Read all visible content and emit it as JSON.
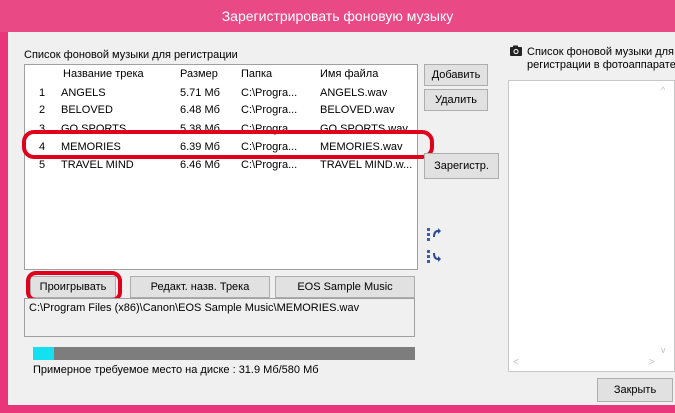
{
  "window": {
    "title": "Зарегистрировать фоновую музыку"
  },
  "left": {
    "group_label": "Список фоновой музыки для регистрации",
    "columns": [
      "Название трека",
      "Размер",
      "Папка",
      "Имя файла"
    ],
    "rows": [
      {
        "num": "1",
        "title": "ANGELS",
        "size": "5.71 Мб",
        "folder": "C:\\Progra...",
        "file": "ANGELS.wav"
      },
      {
        "num": "2",
        "title": "BELOVED",
        "size": "6.48 Мб",
        "folder": "C:\\Progra...",
        "file": "BELOVED.wav"
      },
      {
        "num": "3",
        "title": "GO SPORTS",
        "size": "5.38 Мб",
        "folder": "C:\\Progra...",
        "file": "GO SPORTS.wav"
      },
      {
        "num": "4",
        "title": "MEMORIES",
        "size": "6.39 Мб",
        "folder": "C:\\Progra...",
        "file": "MEMORIES.wav"
      },
      {
        "num": "5",
        "title": "TRAVEL MIND",
        "size": "6.46 Мб",
        "folder": "C:\\Progra...",
        "file": "TRAVEL MIND.w..."
      }
    ],
    "play_button": "Проигрывать",
    "edit_title_button": "Редакт. назв. Трека",
    "sample_button": "EOS Sample Music",
    "file_path": "C:\\Program Files (x86)\\Canon\\EOS Sample Music\\MEMORIES.wav",
    "progress_fraction": 0.055,
    "disk_space_text": "Примерное требуемое место на диске : 31.9 Мб/580 Мб"
  },
  "middle": {
    "add_button": "Добавить",
    "remove_button": "Удалить",
    "register_button": "Зарегистр."
  },
  "right": {
    "label_line1": "Список фоновой музыки для",
    "label_line2": "регистрации в фотоаппарате",
    "close_button": "Закрыть"
  },
  "colors": {
    "title_bar": "#e94a86",
    "highlight": "#e0001b",
    "progress_fill": "#14e0f0"
  }
}
